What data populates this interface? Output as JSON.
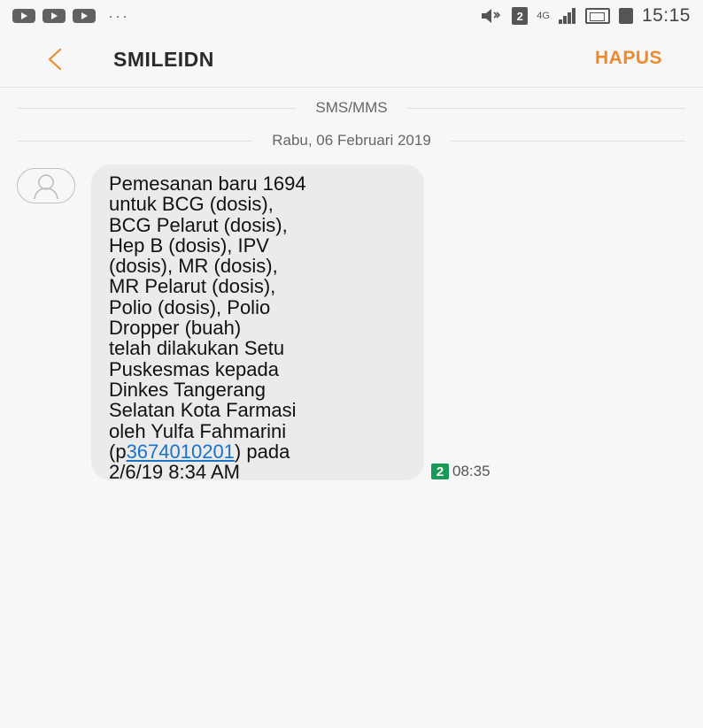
{
  "status_bar": {
    "time": "15:15",
    "more_indicator": "···",
    "sim_label": "2",
    "network_label": "4G",
    "icons": [
      "youtube-icon",
      "youtube-icon",
      "youtube-icon",
      "mute-icon",
      "sim-icon",
      "network-icon",
      "signal-icon",
      "battery-icon"
    ]
  },
  "header": {
    "title": "SMILEIDN",
    "delete_label": "HAPUS",
    "back_icon": "chevron-left-icon",
    "accent_color": "#ee8a2c"
  },
  "conversation": {
    "channel_label": "SMS/MMS",
    "date_label": "Rabu, 06 Februari 2019",
    "messages": [
      {
        "lines": [
          "Pemesanan baru 1694",
          "untuk BCG (dosis),",
          "BCG Pelarut (dosis),",
          "Hep B (dosis), IPV",
          "(dosis), MR (dosis),",
          "MR Pelarut (dosis),",
          "Polio (dosis), Polio",
          "Dropper (buah)",
          "telah dilakukan Setu",
          "Puskesmas kepada",
          "Dinkes Tangerang",
          "Selatan Kota Farmasi",
          "oleh Yulfa Fahmarini"
        ],
        "link_prefix": "(p",
        "link_text": "3674010201",
        "link_suffix": ") pada",
        "last_line": "2/6/19 8:34 AM",
        "sim_badge": "2",
        "time": "08:35"
      }
    ]
  }
}
